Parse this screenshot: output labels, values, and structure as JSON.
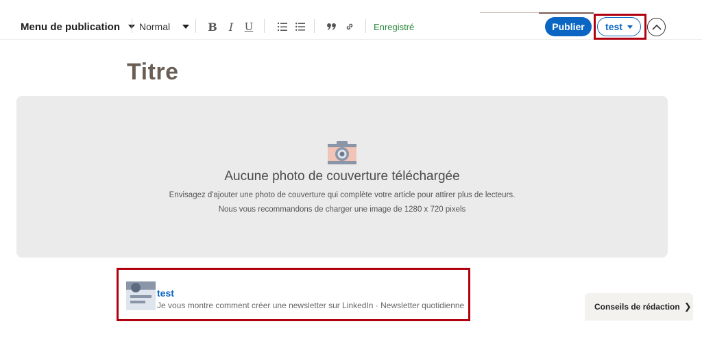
{
  "toolbar": {
    "publishing_menu_label": "Menu de publication",
    "text_style_value": "Normal",
    "bold_label": "B",
    "italic_label": "I",
    "underline_label": "U",
    "saved_status": "Enregistré",
    "publish_label": "Publier",
    "author_label": "test"
  },
  "article": {
    "title_placeholder": "Titre"
  },
  "cover": {
    "heading": "Aucune photo de couverture téléchargée",
    "hint_line_1": "Envisagez d'ajouter une photo de couverture qui complète votre article pour attirer plus de lecteurs.",
    "hint_line_2": "Nous vous recommandons de charger une image de 1280 x 720 pixels"
  },
  "newsletter": {
    "name": "test",
    "description": "Je vous montre comment créer une newsletter sur LinkedIn · Newsletter quotidienne"
  },
  "tips": {
    "label": "Conseils de rédaction",
    "chevron": "❯"
  },
  "colors": {
    "accent_blue": "#0a66c2",
    "highlight_red": "#b00010",
    "saved_green": "#2a8a3b"
  }
}
